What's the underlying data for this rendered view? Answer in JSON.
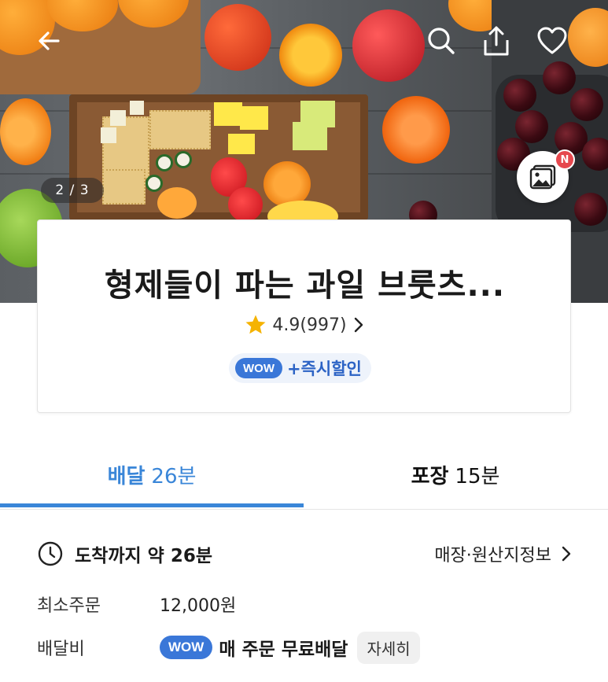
{
  "hero": {
    "image_counter": "2 / 3",
    "new_badge": "N",
    "icons": {
      "back": "back-arrow-icon",
      "search": "search-icon",
      "share": "share-icon",
      "favorite": "heart-icon",
      "photo_review": "photo-review-icon"
    }
  },
  "store": {
    "name": "형제들이 파는 과일 브룻츠...",
    "rating": "4.9(997)",
    "wow_badge": "WOW",
    "wow_label": "+즉시할인"
  },
  "tabs": [
    {
      "bold": "배달",
      "value": "26분",
      "active": true
    },
    {
      "bold": "포장",
      "value": "15분",
      "active": false
    }
  ],
  "delivery": {
    "eta": "도착까지 약 26분",
    "store_info_link": "매장·원산지정보",
    "min_order_label": "최소주문",
    "min_order_value": "12,000원",
    "fee_label": "배달비",
    "fee_wow_badge": "WOW",
    "fee_value": "매 주문 무료배달",
    "detail_button": "자세히"
  },
  "colors": {
    "accent_blue": "#3a86d8",
    "wow_blue": "#3a77d8",
    "star": "#f5b301",
    "badge_red": "#e6484e"
  }
}
